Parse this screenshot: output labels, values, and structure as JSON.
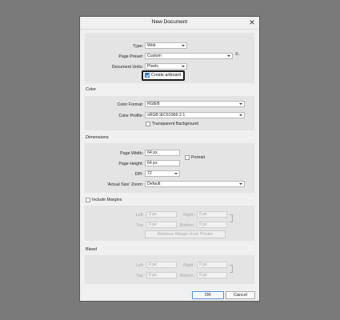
{
  "dialog": {
    "title": "New Document",
    "close_glyph": "✕"
  },
  "document": {
    "type_label": "Type:",
    "type_value": "Web",
    "preset_label": "Page Preset:",
    "preset_value": "Custom",
    "units_label": "Document Units:",
    "units_value": "Pixels",
    "create_artboard_label": "Create artboard",
    "create_artboard_checked": true,
    "preset_menu_icon": "more-options-icon"
  },
  "color": {
    "section": "Color",
    "format_label": "Color Format:",
    "format_value": "RGB/8",
    "profile_label": "Color Profile:",
    "profile_value": "sRGB IEC61966-2.1",
    "transparent_label": "Transparent Background",
    "transparent_checked": false
  },
  "dimensions": {
    "section": "Dimensions",
    "width_label": "Page Width:",
    "width_value": "64 px",
    "height_label": "Page Height:",
    "height_value": "64 px",
    "portrait_label": "Portrait",
    "portrait_checked": false,
    "dpi_label": "DPI:",
    "dpi_value": "72",
    "zoom_label": "'Actual Size' Zoom:",
    "zoom_value": "Default"
  },
  "margins": {
    "include_label": "Include Margins",
    "include_checked": false,
    "left_label": "Left:",
    "left_value": "0 px",
    "right_label": "Right:",
    "right_value": "0 px",
    "top_label": "Top:",
    "top_value": "0 px",
    "bottom_label": "Bottom:",
    "bottom_value": "0 px",
    "retrieve_label": "Retrieve Margin from Printer"
  },
  "bleed": {
    "section": "Bleed",
    "left_label": "Left:",
    "left_value": "0 px",
    "right_label": "Right:",
    "right_value": "0 px",
    "top_label": "Top:",
    "top_value": "0 px",
    "bottom_label": "Bottom:",
    "bottom_value": "0 px"
  },
  "buttons": {
    "ok": "OK",
    "cancel": "Cancel"
  },
  "colors": {
    "accent": "#2e7fd6",
    "backdrop": "#7a7a7a",
    "panel": "#e4e4e4"
  }
}
